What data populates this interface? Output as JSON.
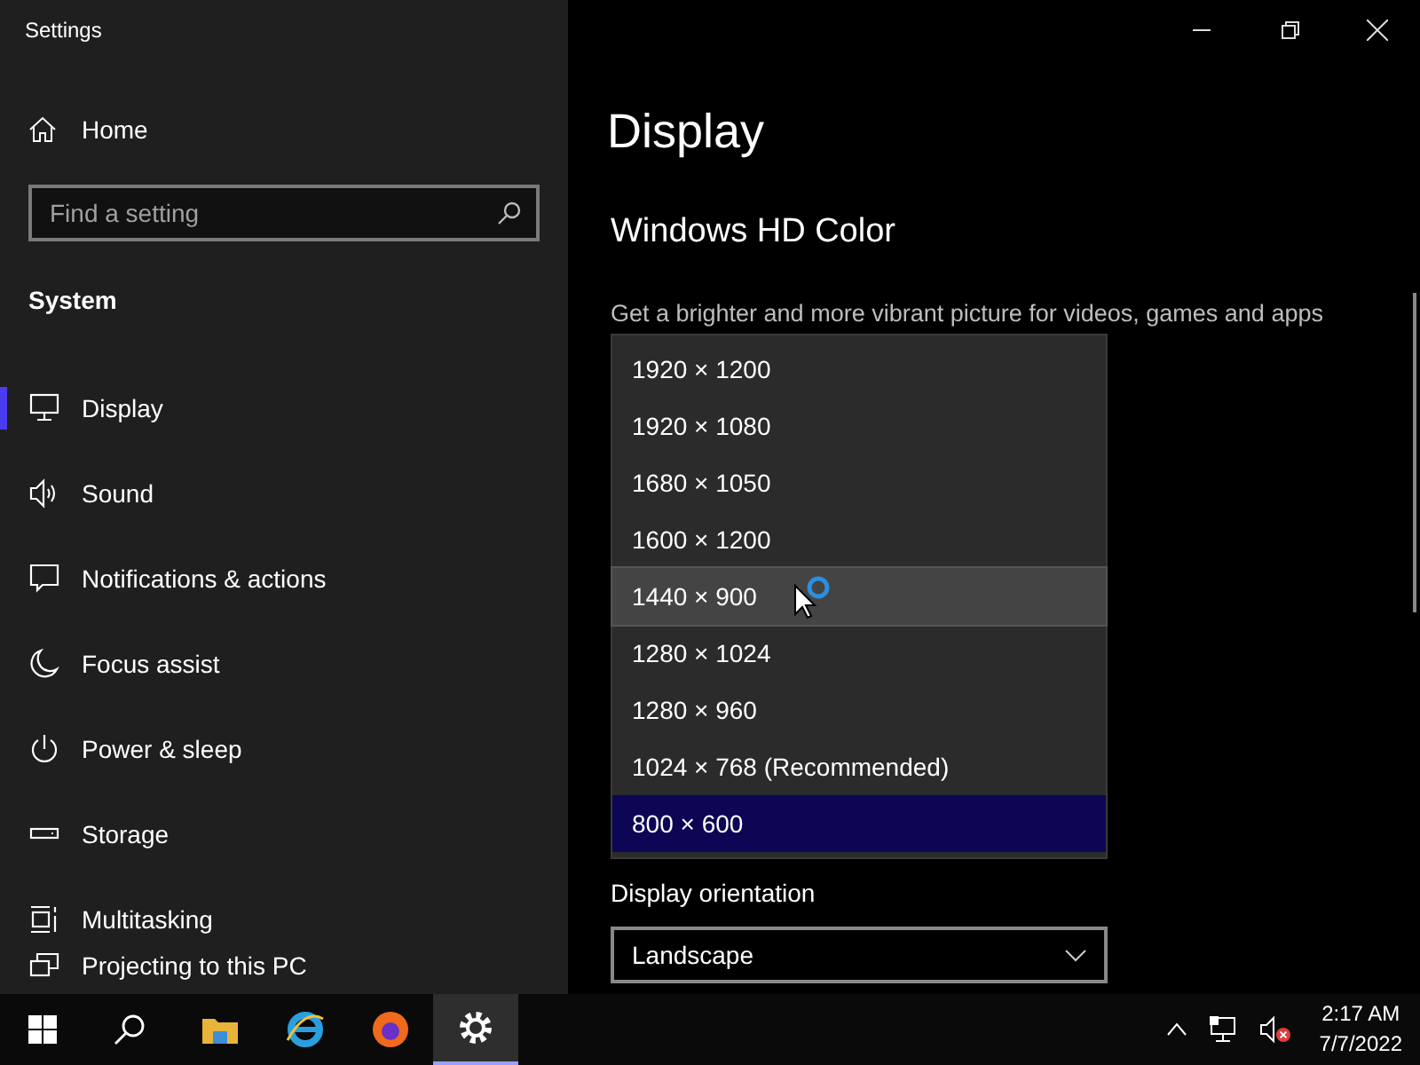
{
  "window": {
    "title": "Settings"
  },
  "sidebar": {
    "home": "Home",
    "search": {
      "placeholder": "Find a setting"
    },
    "section": "System",
    "items": [
      {
        "label": "Display",
        "selected": true
      },
      {
        "label": "Sound",
        "selected": false
      },
      {
        "label": "Notifications & actions",
        "selected": false
      },
      {
        "label": "Focus assist",
        "selected": false
      },
      {
        "label": "Power & sleep",
        "selected": false
      },
      {
        "label": "Storage",
        "selected": false
      },
      {
        "label": "Multitasking",
        "selected": false
      },
      {
        "label": "Projecting to this PC",
        "selected": false
      }
    ]
  },
  "content": {
    "title": "Display",
    "section": "Windows HD Color",
    "description": "Get a brighter and more vibrant picture for videos, games and apps",
    "orientation": {
      "label": "Display orientation",
      "value": "Landscape"
    }
  },
  "resolution_dropdown": {
    "options": [
      {
        "label": "1920 × 1200",
        "selected": false,
        "hovered": false
      },
      {
        "label": "1920 × 1080",
        "selected": false,
        "hovered": false
      },
      {
        "label": "1680 × 1050",
        "selected": false,
        "hovered": false
      },
      {
        "label": "1600 × 1200",
        "selected": false,
        "hovered": false
      },
      {
        "label": "1440 × 900",
        "selected": false,
        "hovered": true
      },
      {
        "label": "1280 × 1024",
        "selected": false,
        "hovered": false
      },
      {
        "label": "1280 × 960",
        "selected": false,
        "hovered": false
      },
      {
        "label": "1024 × 768 (Recommended)",
        "selected": false,
        "hovered": false
      },
      {
        "label": "800 × 600",
        "selected": true,
        "hovered": false
      }
    ]
  },
  "taskbar": {
    "apps": [
      {
        "active": false
      },
      {
        "active": false
      },
      {
        "active": false
      },
      {
        "active": true
      }
    ],
    "time": "2:17 AM",
    "date": "7/7/2022"
  }
}
